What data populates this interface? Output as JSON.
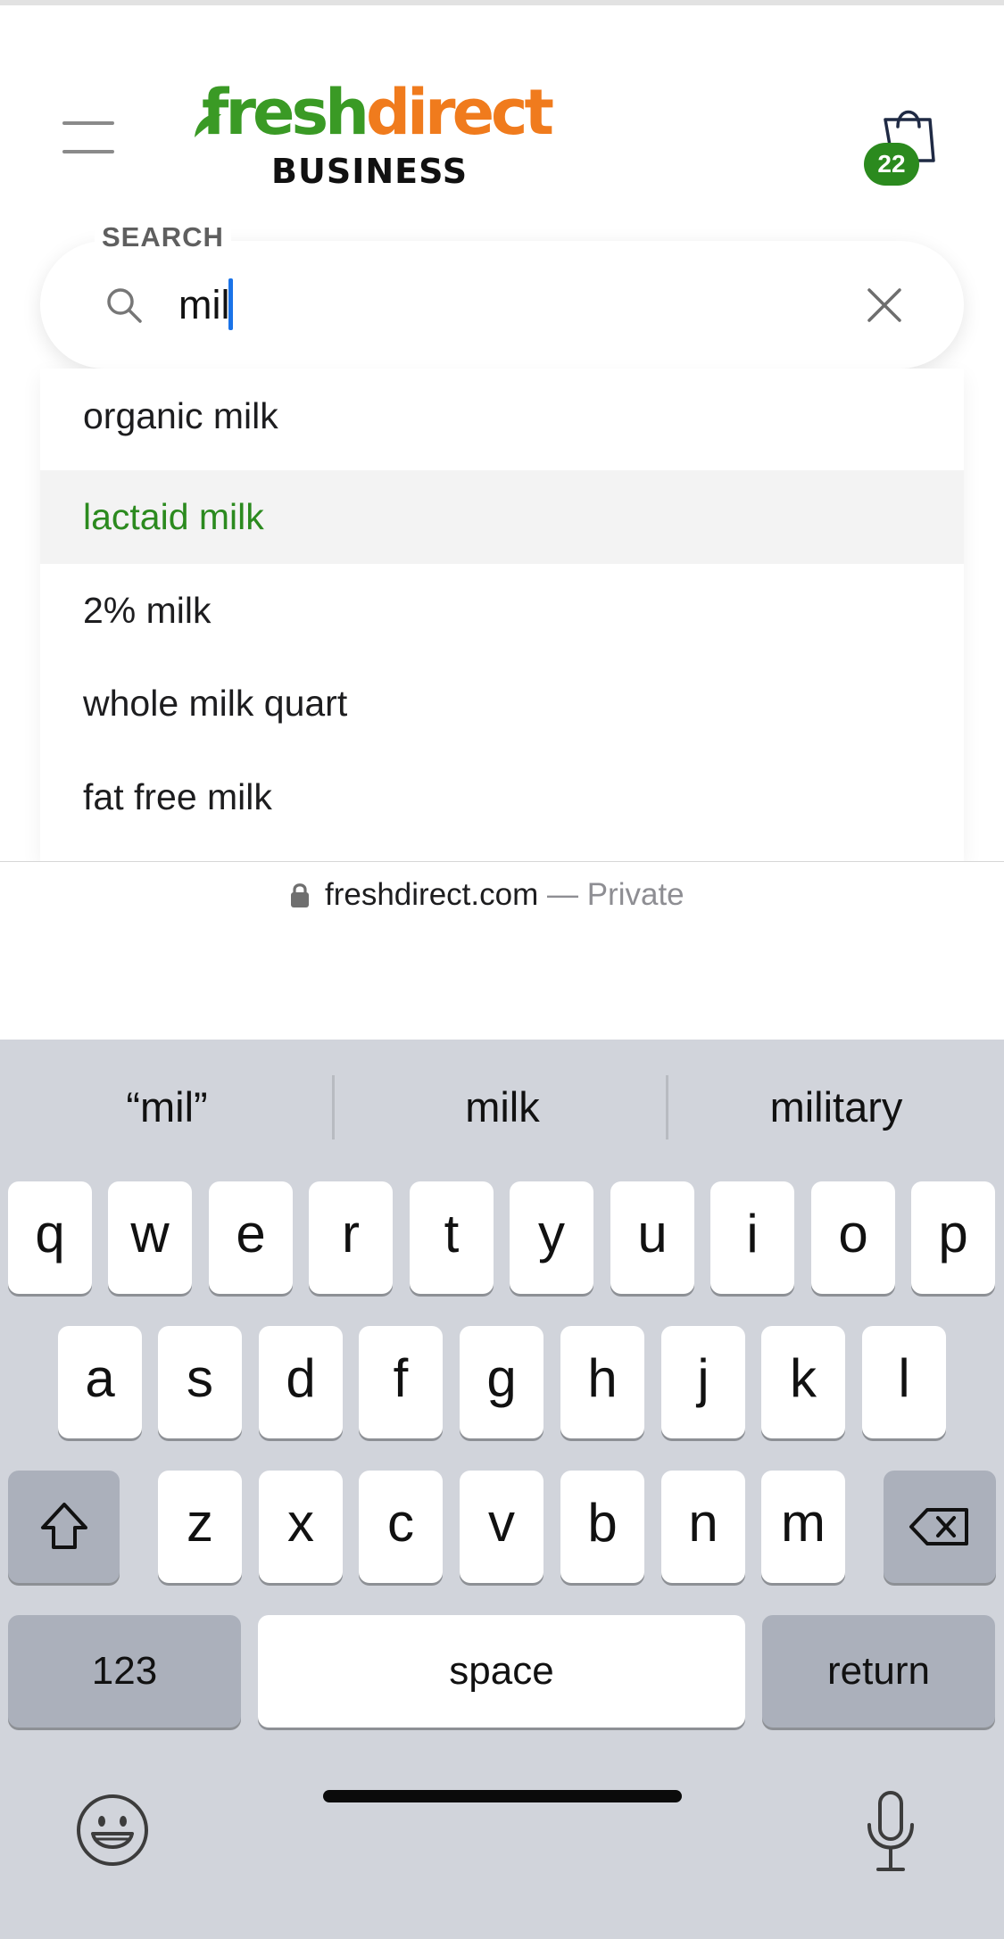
{
  "header": {
    "menu_icon": "hamburger-menu-icon",
    "logo": {
      "fresh": "fresh",
      "direct": "direct",
      "business": "BUSINESS"
    },
    "cart": {
      "icon": "shopping-bag-icon",
      "count": "22",
      "badge_color": "#2b8a1e"
    }
  },
  "search": {
    "label": "SEARCH",
    "value": "mil",
    "icon": "search-icon",
    "clear_icon": "close-icon"
  },
  "suggestions": [
    {
      "label": "organic milk",
      "highlighted": false
    },
    {
      "label": "lactaid milk",
      "highlighted": true
    },
    {
      "label": "2% milk",
      "highlighted": false
    },
    {
      "label": "whole milk quart",
      "highlighted": false
    },
    {
      "label": "fat free milk",
      "highlighted": false
    }
  ],
  "browser": {
    "domain": "freshdirect.com",
    "separator": " — ",
    "status": "Private",
    "lock_icon": "lock-icon"
  },
  "keyboard": {
    "predictions": [
      "“mil”",
      "milk",
      "military"
    ],
    "row1": [
      "q",
      "w",
      "e",
      "r",
      "t",
      "y",
      "u",
      "i",
      "o",
      "p"
    ],
    "row2": [
      "a",
      "s",
      "d",
      "f",
      "g",
      "h",
      "j",
      "k",
      "l"
    ],
    "row3": [
      "z",
      "x",
      "c",
      "v",
      "b",
      "n",
      "m"
    ],
    "numbers_key": "123",
    "space_key": "space",
    "return_key": "return",
    "shift_icon": "shift-icon",
    "backspace_icon": "backspace-icon",
    "emoji_icon": "emoji-icon",
    "mic_icon": "microphone-icon"
  },
  "colors": {
    "brand_green": "#3a9a25",
    "brand_orange": "#f07b1d",
    "highlight_green": "#2b8a1e",
    "caret_blue": "#1a73e8",
    "keyboard_bg": "#d1d4db"
  }
}
